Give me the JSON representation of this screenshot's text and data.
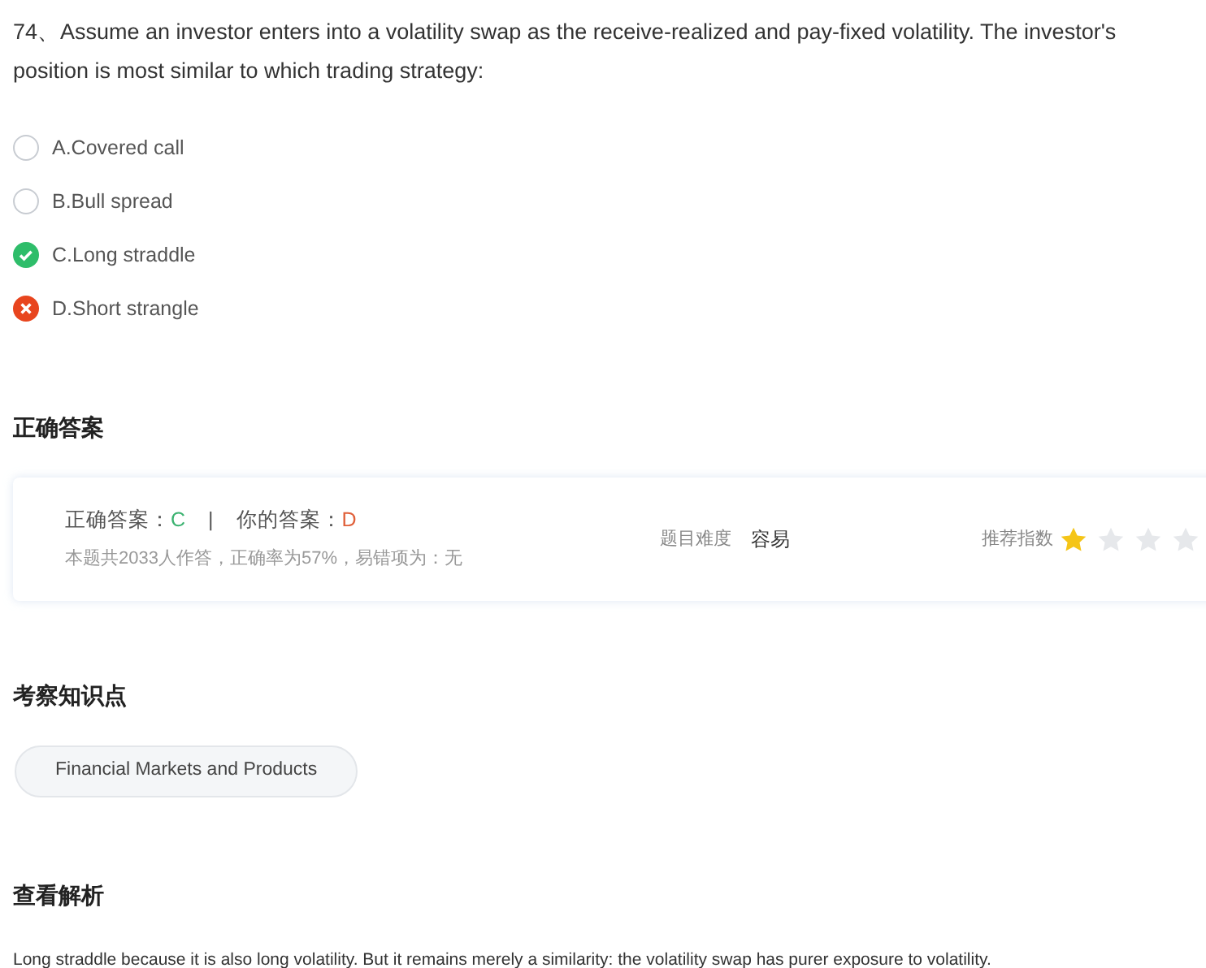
{
  "question": {
    "text": "74、Assume an investor enters into a volatility swap as the receive-realized and pay-fixed volatility. The investor's position is most similar to which trading strategy:"
  },
  "options": [
    {
      "label": "A.Covered call",
      "kind": "none"
    },
    {
      "label": "B.Bull spread",
      "kind": "none"
    },
    {
      "label": "C.Long straddle",
      "kind": "correct"
    },
    {
      "label": "D.Short strangle",
      "kind": "wrong"
    }
  ],
  "answer_section": {
    "heading": "正确答案",
    "correct_label": "正确答案：",
    "correct_value": "C",
    "separator": "|",
    "your_label": "你的答案：",
    "your_value": "D",
    "stats": "本题共2033人作答，正确率为57%，易错项为：无",
    "difficulty_label": "题目难度",
    "difficulty_value": "容易",
    "rating_label": "推荐指数",
    "rating": {
      "stars": 1
    }
  },
  "knowledge_section": {
    "heading": "考察知识点",
    "tags": [
      "Financial Markets and Products"
    ]
  },
  "analysis_section": {
    "heading": "查看解析",
    "text": "Long straddle because it is also long volatility. But it remains merely a similarity: the volatility swap has purer exposure to volatility."
  }
}
